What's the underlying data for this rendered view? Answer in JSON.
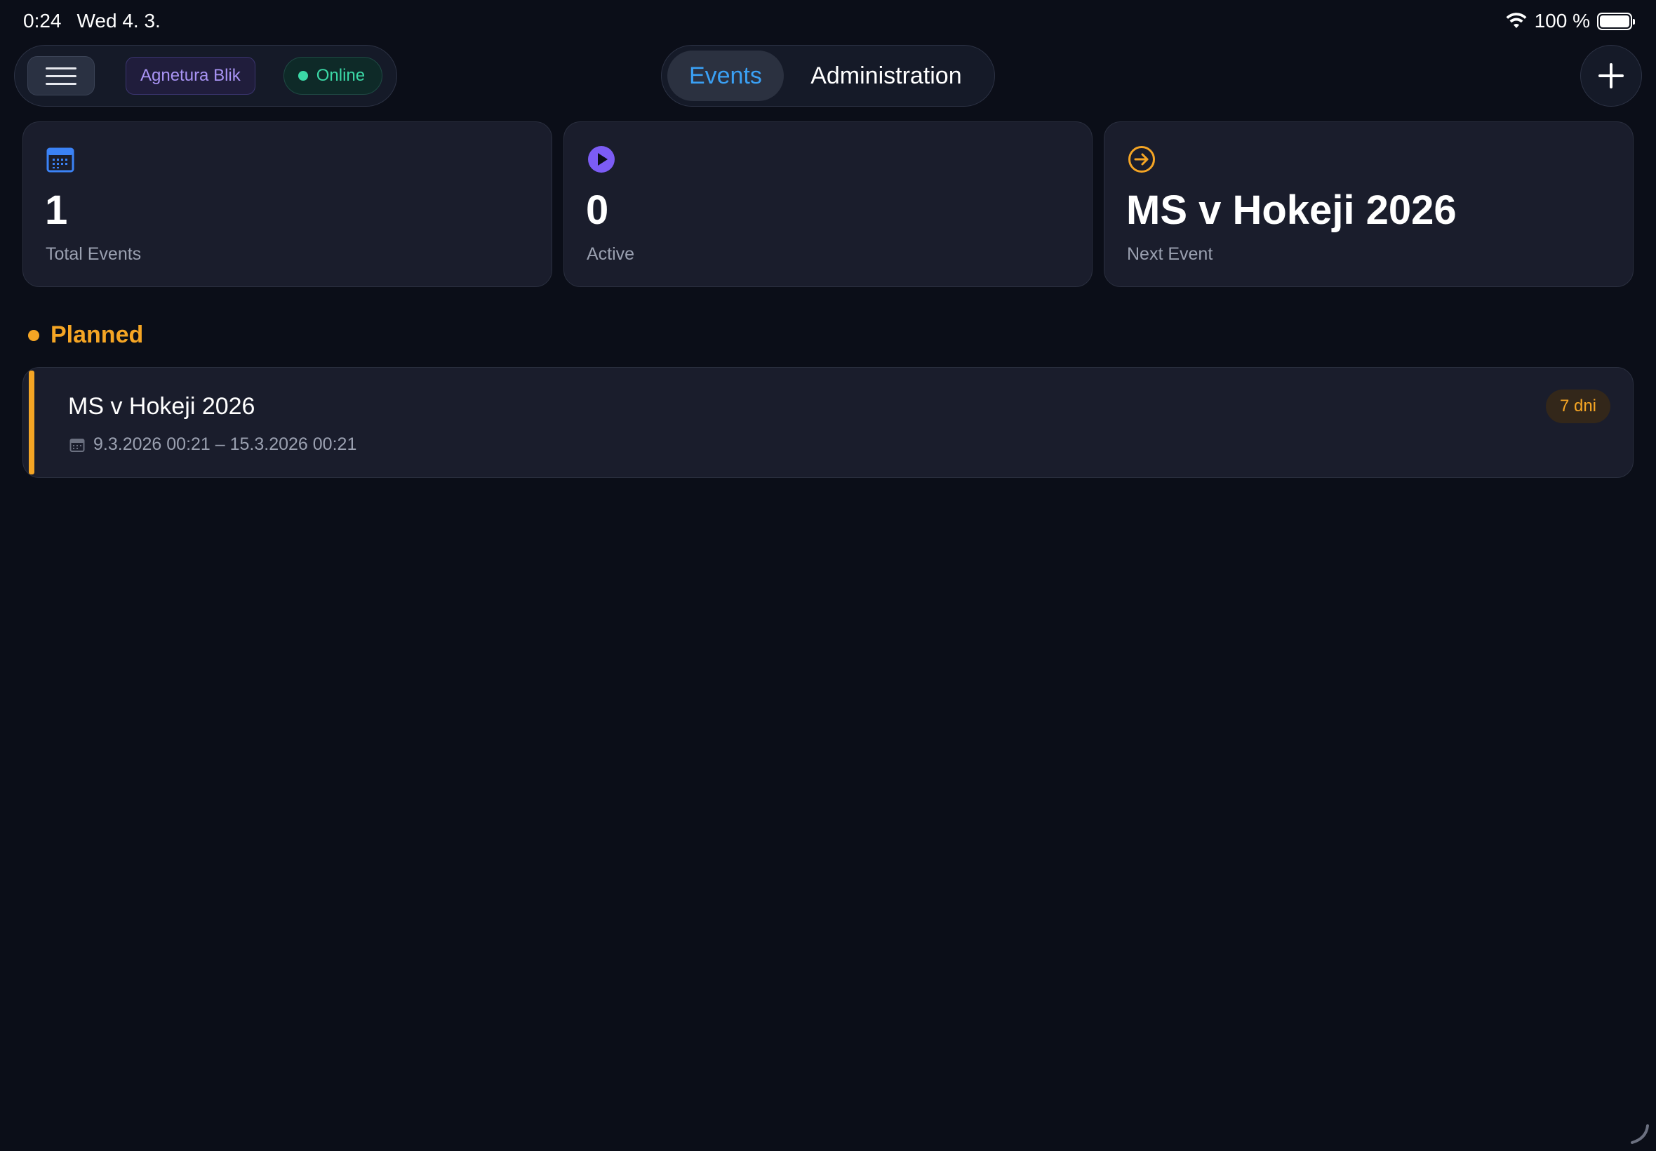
{
  "status_bar": {
    "time": "0:24",
    "date": "Wed 4. 3.",
    "battery": "100 %",
    "icons": [
      "wifi-icon",
      "battery-icon"
    ]
  },
  "toolbar": {
    "menu_icon": "hamburger-menu-icon",
    "user": "Agnetura Blik",
    "connection_status": "Online",
    "tabs": [
      {
        "label": "Events",
        "selected": true
      },
      {
        "label": "Administration",
        "selected": false
      }
    ],
    "add_icon": "plus-icon"
  },
  "stats": [
    {
      "icon": "calendar-icon",
      "value": "1",
      "label": "Total Events",
      "color": "#3b82f6"
    },
    {
      "icon": "play-icon",
      "value": "0",
      "label": "Active",
      "color": "#7c5cf5"
    },
    {
      "icon": "arrow-right-circle-icon",
      "value": "MS v Hokeji 2026",
      "label": "Next Event",
      "color": "#f5a524"
    }
  ],
  "sections": [
    {
      "title": "Planned",
      "color": "#f5a524",
      "events": [
        {
          "title": "MS v Hokeji 2026",
          "dates": "9.3.2026 00:21  –  15.3.2026 00:21",
          "badge": "7 dni"
        }
      ]
    }
  ],
  "colors": {
    "background": "#0b0e18",
    "card": "#1a1d2c",
    "accent_blue": "#3aa0f4",
    "online_green": "#3bd8a6",
    "planned_orange": "#f5a524"
  }
}
